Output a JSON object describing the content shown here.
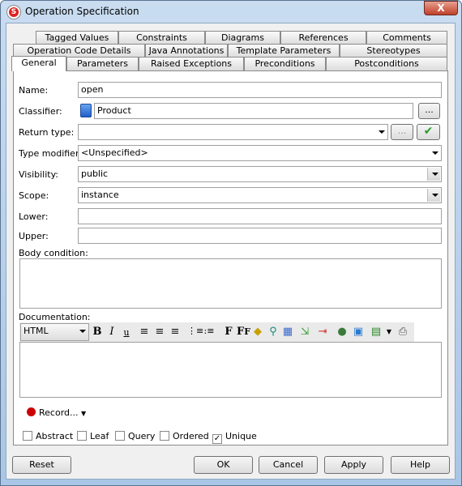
{
  "window": {
    "title": "Operation Specification",
    "close": "X"
  },
  "tabs": {
    "row1": [
      "Tagged Values",
      "Constraints",
      "Diagrams",
      "References",
      "Comments"
    ],
    "row2": [
      "Operation Code Details",
      "Java Annotations",
      "Template Parameters",
      "Stereotypes"
    ],
    "row3": [
      "General",
      "Parameters",
      "Raised Exceptions",
      "Preconditions",
      "Postconditions"
    ],
    "active": "General"
  },
  "form": {
    "name_label": "Name:",
    "name_value": "open",
    "classifier_label": "Classifier:",
    "classifier_value": "Product",
    "browse": "...",
    "return_type_label": "Return type:",
    "return_type_value": "",
    "return_browse": "...",
    "type_modifier_label": "Type modifier:",
    "type_modifier_value": "<Unspecified>",
    "visibility_label": "Visibility:",
    "visibility_value": "public",
    "scope_label": "Scope:",
    "scope_value": "instance",
    "lower_label": "Lower:",
    "lower_value": "",
    "upper_label": "Upper:",
    "upper_value": "",
    "body_condition_label": "Body condition:",
    "documentation_label": "Documentation:",
    "doc_format": "HTML",
    "record_label": "Record..."
  },
  "checkboxes": [
    {
      "label": "Abstract",
      "checked": false
    },
    {
      "label": "Leaf",
      "checked": false
    },
    {
      "label": "Query",
      "checked": false
    },
    {
      "label": "Ordered",
      "checked": false
    },
    {
      "label": "Unique",
      "checked": true
    }
  ],
  "buttons": {
    "reset": "Reset",
    "ok": "OK",
    "cancel": "Cancel",
    "apply": "Apply",
    "help": "Help"
  },
  "colors": {
    "record": "#cc0000",
    "check_ok": "#2a9a2a"
  }
}
